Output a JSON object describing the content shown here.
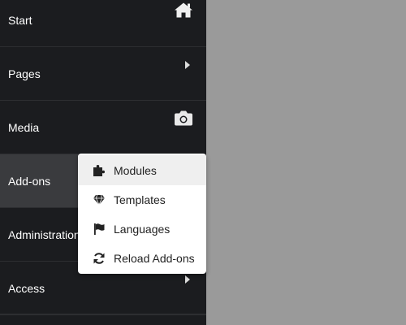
{
  "sidebar": {
    "items": [
      {
        "label": "Start",
        "icon": "home-icon"
      },
      {
        "label": "Pages",
        "icon": "chevron-right-icon"
      },
      {
        "label": "Media",
        "icon": "camera-icon"
      },
      {
        "label": "Add-ons",
        "icon": "",
        "active": true
      },
      {
        "label": "Administration",
        "icon": "chevron-right-icon"
      },
      {
        "label": "Access",
        "icon": "chevron-right-icon"
      }
    ]
  },
  "dropdown": {
    "items": [
      {
        "label": "Modules",
        "icon": "puzzle-icon",
        "highlighted": true
      },
      {
        "label": "Templates",
        "icon": "gem-icon"
      },
      {
        "label": "Languages",
        "icon": "flag-icon"
      },
      {
        "label": "Reload Add-ons",
        "icon": "refresh-icon"
      }
    ]
  },
  "colors": {
    "sidebar_bg": "#1b1c1f",
    "active_bg": "#3a3b3e",
    "content_bg": "#9a9a9a",
    "dropdown_bg": "#ffffff",
    "dropdown_hover": "#efefef"
  }
}
